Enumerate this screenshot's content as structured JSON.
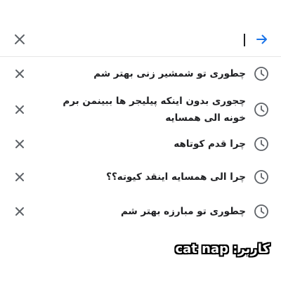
{
  "search": {
    "value": "",
    "placeholder": ""
  },
  "suggestions": [
    {
      "text": "چطوری تو شمشیر زنی بهتر شم",
      "icon": "history-icon"
    },
    {
      "text": "چجوری بدون اینکه پیلیجر ها ببینمن برم خونه الی همسایه",
      "icon": "history-icon"
    },
    {
      "text": "چرا قدم کوتاهه",
      "icon": "history-icon"
    },
    {
      "text": "چرا الی همسایه اینقد کیوته؟؟",
      "icon": "history-icon"
    },
    {
      "text": "چطوری تو مبارزه بهتر شم",
      "icon": "history-icon"
    }
  ],
  "watermark": "کاربر: cat nap",
  "colors": {
    "accent": "#1a73e8",
    "icon_gray": "#5f6368",
    "text": "#202124",
    "divider": "#e6e6e6"
  }
}
